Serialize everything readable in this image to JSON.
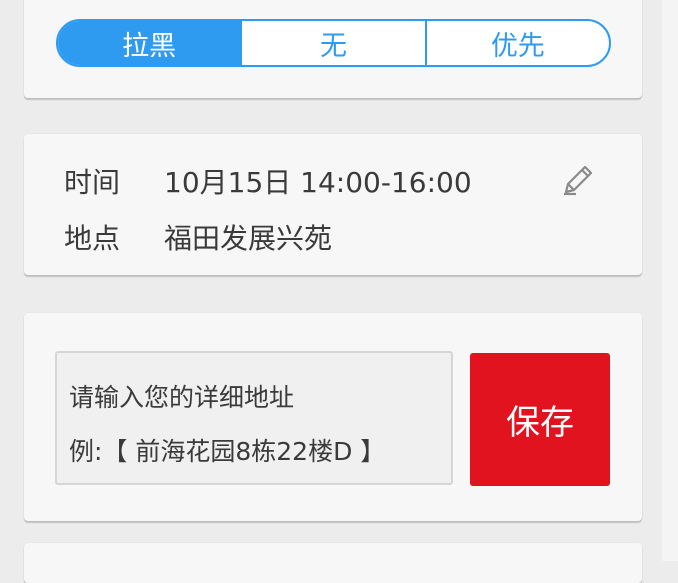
{
  "priority": {
    "options": [
      "拉黑",
      "无",
      "优先"
    ],
    "selected": "拉黑"
  },
  "appointment": {
    "time_label": "时间",
    "time_value": "10月15日 14:00-16:00",
    "place_label": "地点",
    "place_value": "福田发展兴苑",
    "edit_icon": "pencil-icon"
  },
  "address": {
    "placeholder_line1": "请输入您的详细地址",
    "placeholder_line2": "例:【 前海花园8栋22楼D 】",
    "save_label": "保存"
  },
  "colors": {
    "accent_blue": "#2e9bf0",
    "save_red": "#e0131e",
    "background": "#ececec",
    "card": "#f7f7f7"
  }
}
